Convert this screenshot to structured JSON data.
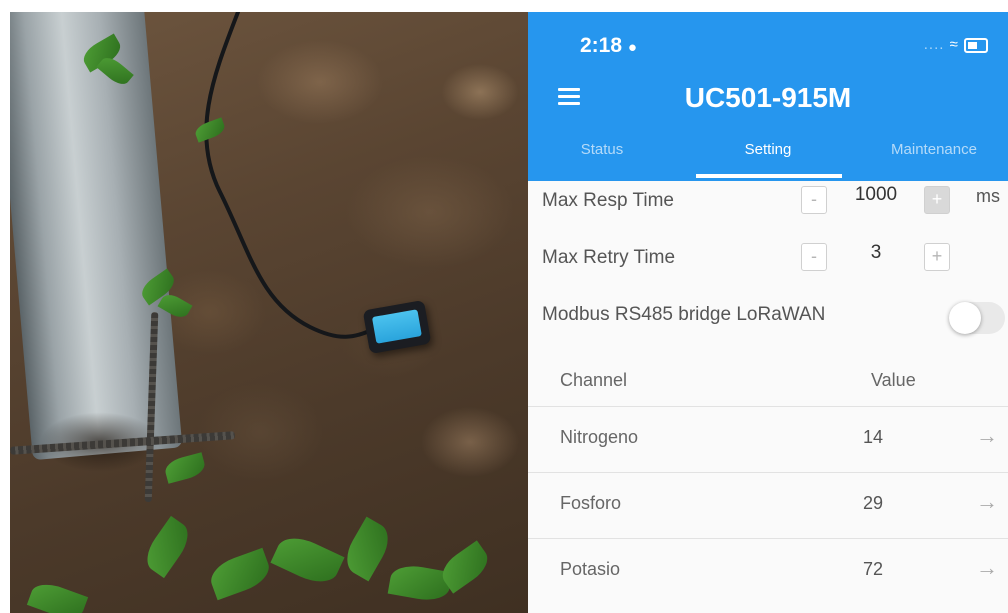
{
  "status_bar": {
    "time": "2:18",
    "person_icon": "person-icon",
    "signal": "....",
    "wifi_icon": "wifi-icon",
    "battery_icon": "battery-icon"
  },
  "header": {
    "title": "UC501-915M",
    "menu_icon": "hamburger-menu-icon"
  },
  "tabs": [
    {
      "label": "Status",
      "active": false
    },
    {
      "label": "Setting",
      "active": true
    },
    {
      "label": "Maintenance",
      "active": false
    }
  ],
  "settings": {
    "max_resp_time": {
      "label": "Max Resp Time",
      "minus": "-",
      "value": "1000",
      "plus": "+",
      "unit": "ms"
    },
    "max_retry_time": {
      "label": "Max Retry Time",
      "minus": "-",
      "value": "3",
      "plus": "+"
    },
    "modbus_bridge": {
      "label": "Modbus RS485 bridge LoRaWAN",
      "enabled": false
    }
  },
  "channel_table": {
    "headers": {
      "channel": "Channel",
      "value": "Value"
    },
    "rows": [
      {
        "channel": "Nitrogeno",
        "value": "14",
        "arrow": "→"
      },
      {
        "channel": "Fosforo",
        "value": "29",
        "arrow": "→"
      },
      {
        "channel": "Potasio",
        "value": "72",
        "arrow": "→"
      }
    ]
  },
  "colors": {
    "accent": "#2696ee",
    "background": "#fafafa",
    "sensor_face": "#35b1e6"
  },
  "photo": {
    "contents": [
      "soil",
      "metal-pole",
      "rebar",
      "cable",
      "sensor-device",
      "plant-leaves"
    ]
  }
}
